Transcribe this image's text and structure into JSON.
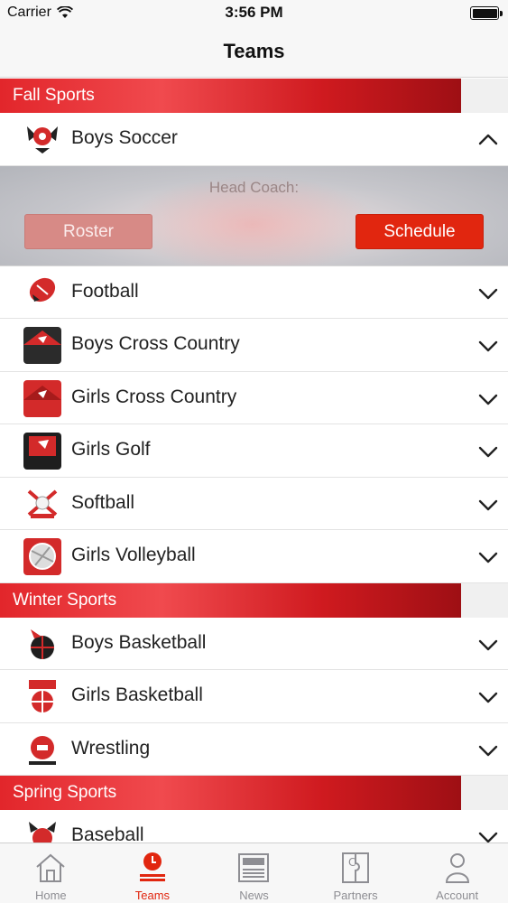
{
  "status_bar": {
    "carrier": "Carrier",
    "time": "3:56 PM"
  },
  "nav": {
    "title": "Teams"
  },
  "colors": {
    "accent": "#e1260f",
    "section_red": "#e2262b",
    "roster_button": "#d78a86"
  },
  "sections": [
    {
      "label": "Fall Sports",
      "teams": [
        {
          "name": "Boys Soccer",
          "logo_text": "BOYS SOCCER",
          "expanded": true,
          "head_coach_label": "Head Coach:",
          "roster_label": "Roster",
          "schedule_label": "Schedule"
        },
        {
          "name": "Football",
          "logo_text": "FOOTBALL"
        },
        {
          "name": "Boys Cross Country",
          "logo_text": "BOYS CROSS COUNTRY"
        },
        {
          "name": "Girls Cross Country",
          "logo_text": "GIRLS CROSS COUNTRY"
        },
        {
          "name": "Girls Golf",
          "logo_text": "GIRLS GOLF"
        },
        {
          "name": "Softball",
          "logo_text": "SOFTBALL"
        },
        {
          "name": "Girls Volleyball",
          "logo_text": "GIRLS VOLLEYBALL"
        }
      ]
    },
    {
      "label": "Winter Sports",
      "teams": [
        {
          "name": "Boys Basketball",
          "logo_text": "BOYS BASKETBALL"
        },
        {
          "name": "Girls Basketball",
          "logo_text": "GIRLS BASKETBALL"
        },
        {
          "name": "Wrestling",
          "logo_text": "WRESTLING"
        }
      ]
    },
    {
      "label": "Spring Sports",
      "teams": [
        {
          "name": "Baseball",
          "logo_text": "BASEBALL"
        }
      ]
    }
  ],
  "tabs": [
    {
      "label": "Home",
      "icon": "home-icon",
      "active": false
    },
    {
      "label": "Teams",
      "icon": "teams-icon",
      "active": true
    },
    {
      "label": "News",
      "icon": "news-icon",
      "active": false
    },
    {
      "label": "Partners",
      "icon": "partners-icon",
      "active": false
    },
    {
      "label": "Account",
      "icon": "account-icon",
      "active": false
    }
  ]
}
